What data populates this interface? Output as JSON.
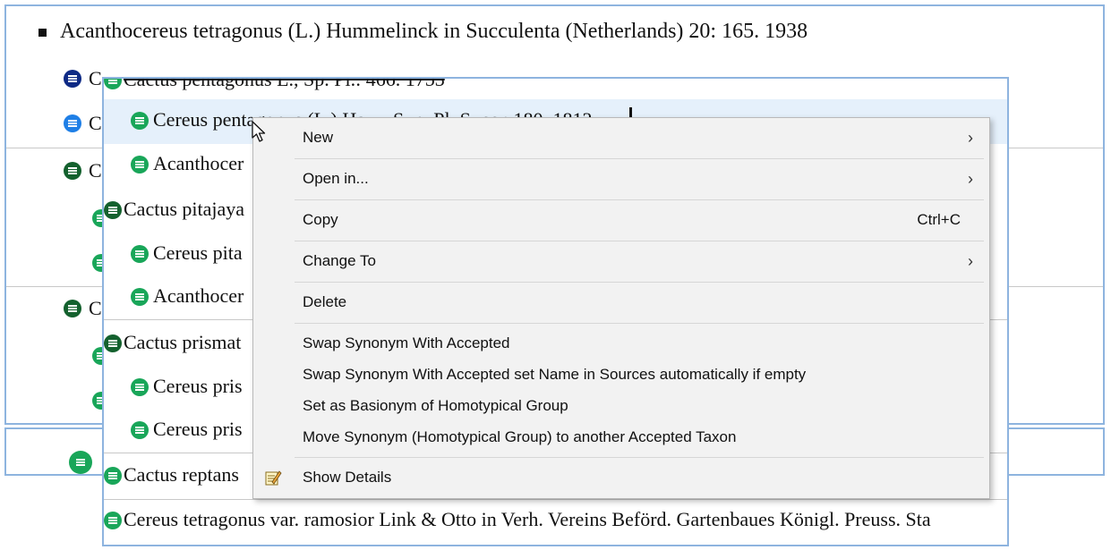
{
  "back_tree": {
    "header": "Acanthocereus tetragonus (L.) Hummelinck in Succulenta (Netherlands) 20: 165. 1938",
    "clipped_labels": [
      "C",
      "C",
      "C",
      "C"
    ]
  },
  "front_tree": {
    "rows": [
      "Cactus pentagonus L., Sp. Pl.: 466. 1753",
      "Cereus pentagonus (L.) Haw., Syn. Pl. Succ.: 180. 1812",
      "Acanthocer",
      "Cactus pitajaya",
      "Cereus pita",
      "Acanthocer",
      "Cactus prismat",
      "Cereus pris",
      "Cereus pris",
      "Cactus reptans",
      "Cereus tetragonus var. ramosior Link & Otto in Verh. Vereins Beförd. Gartenbaues Königl. Preuss. Sta"
    ]
  },
  "context_menu": {
    "new": "New",
    "open_in": "Open in...",
    "copy": "Copy",
    "copy_shortcut": "Ctrl+C",
    "change_to": "Change To",
    "delete": "Delete",
    "swap_synonym": "Swap Synonym With Accepted",
    "swap_synonym_auto": "Swap Synonym With Accepted set Name in Sources automatically if empty",
    "set_basionym": "Set as Basionym of Homotypical Group",
    "move_synonym": "Move Synonym (Homotypical Group) to another Accepted Taxon",
    "show_details": "Show Details"
  }
}
